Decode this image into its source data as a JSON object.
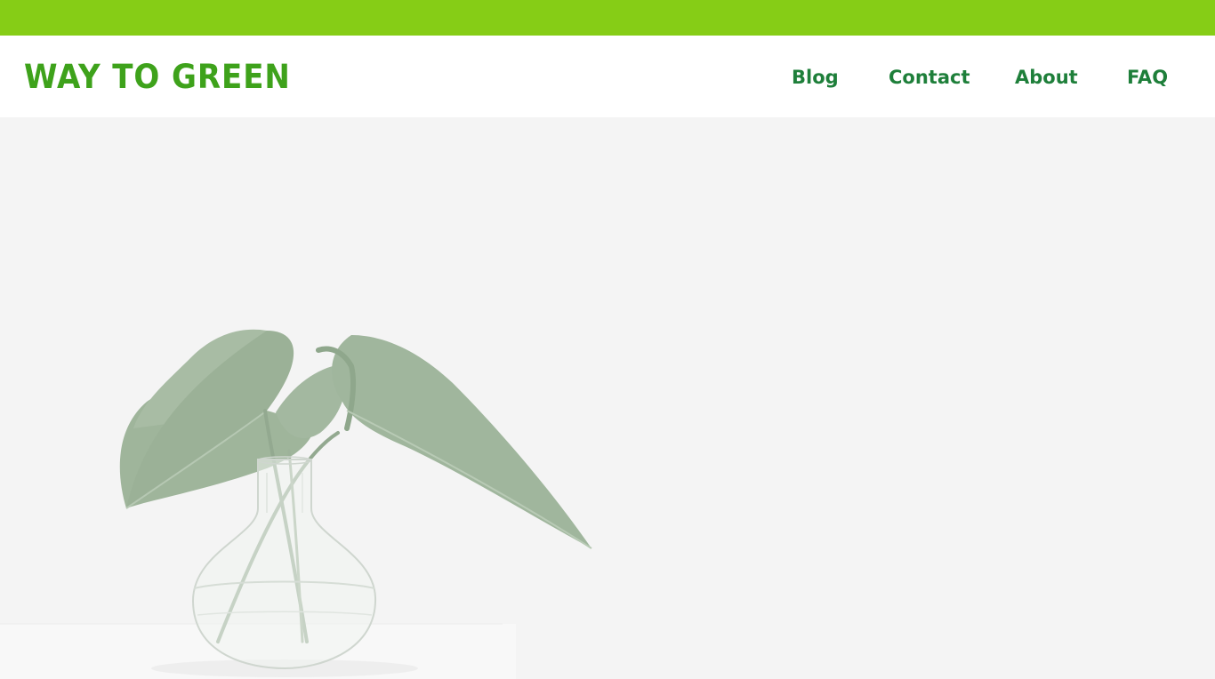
{
  "brand": {
    "logo_text": "WAY TO GREEN",
    "accent_color": "#86cd16",
    "logo_color": "#3ea21b",
    "nav_color": "#1e7f3a"
  },
  "nav": {
    "items": [
      {
        "label": "Blog"
      },
      {
        "label": "Contact"
      },
      {
        "label": "About"
      },
      {
        "label": "FAQ"
      }
    ]
  },
  "hero": {
    "image": "plant-in-glass-vase"
  }
}
